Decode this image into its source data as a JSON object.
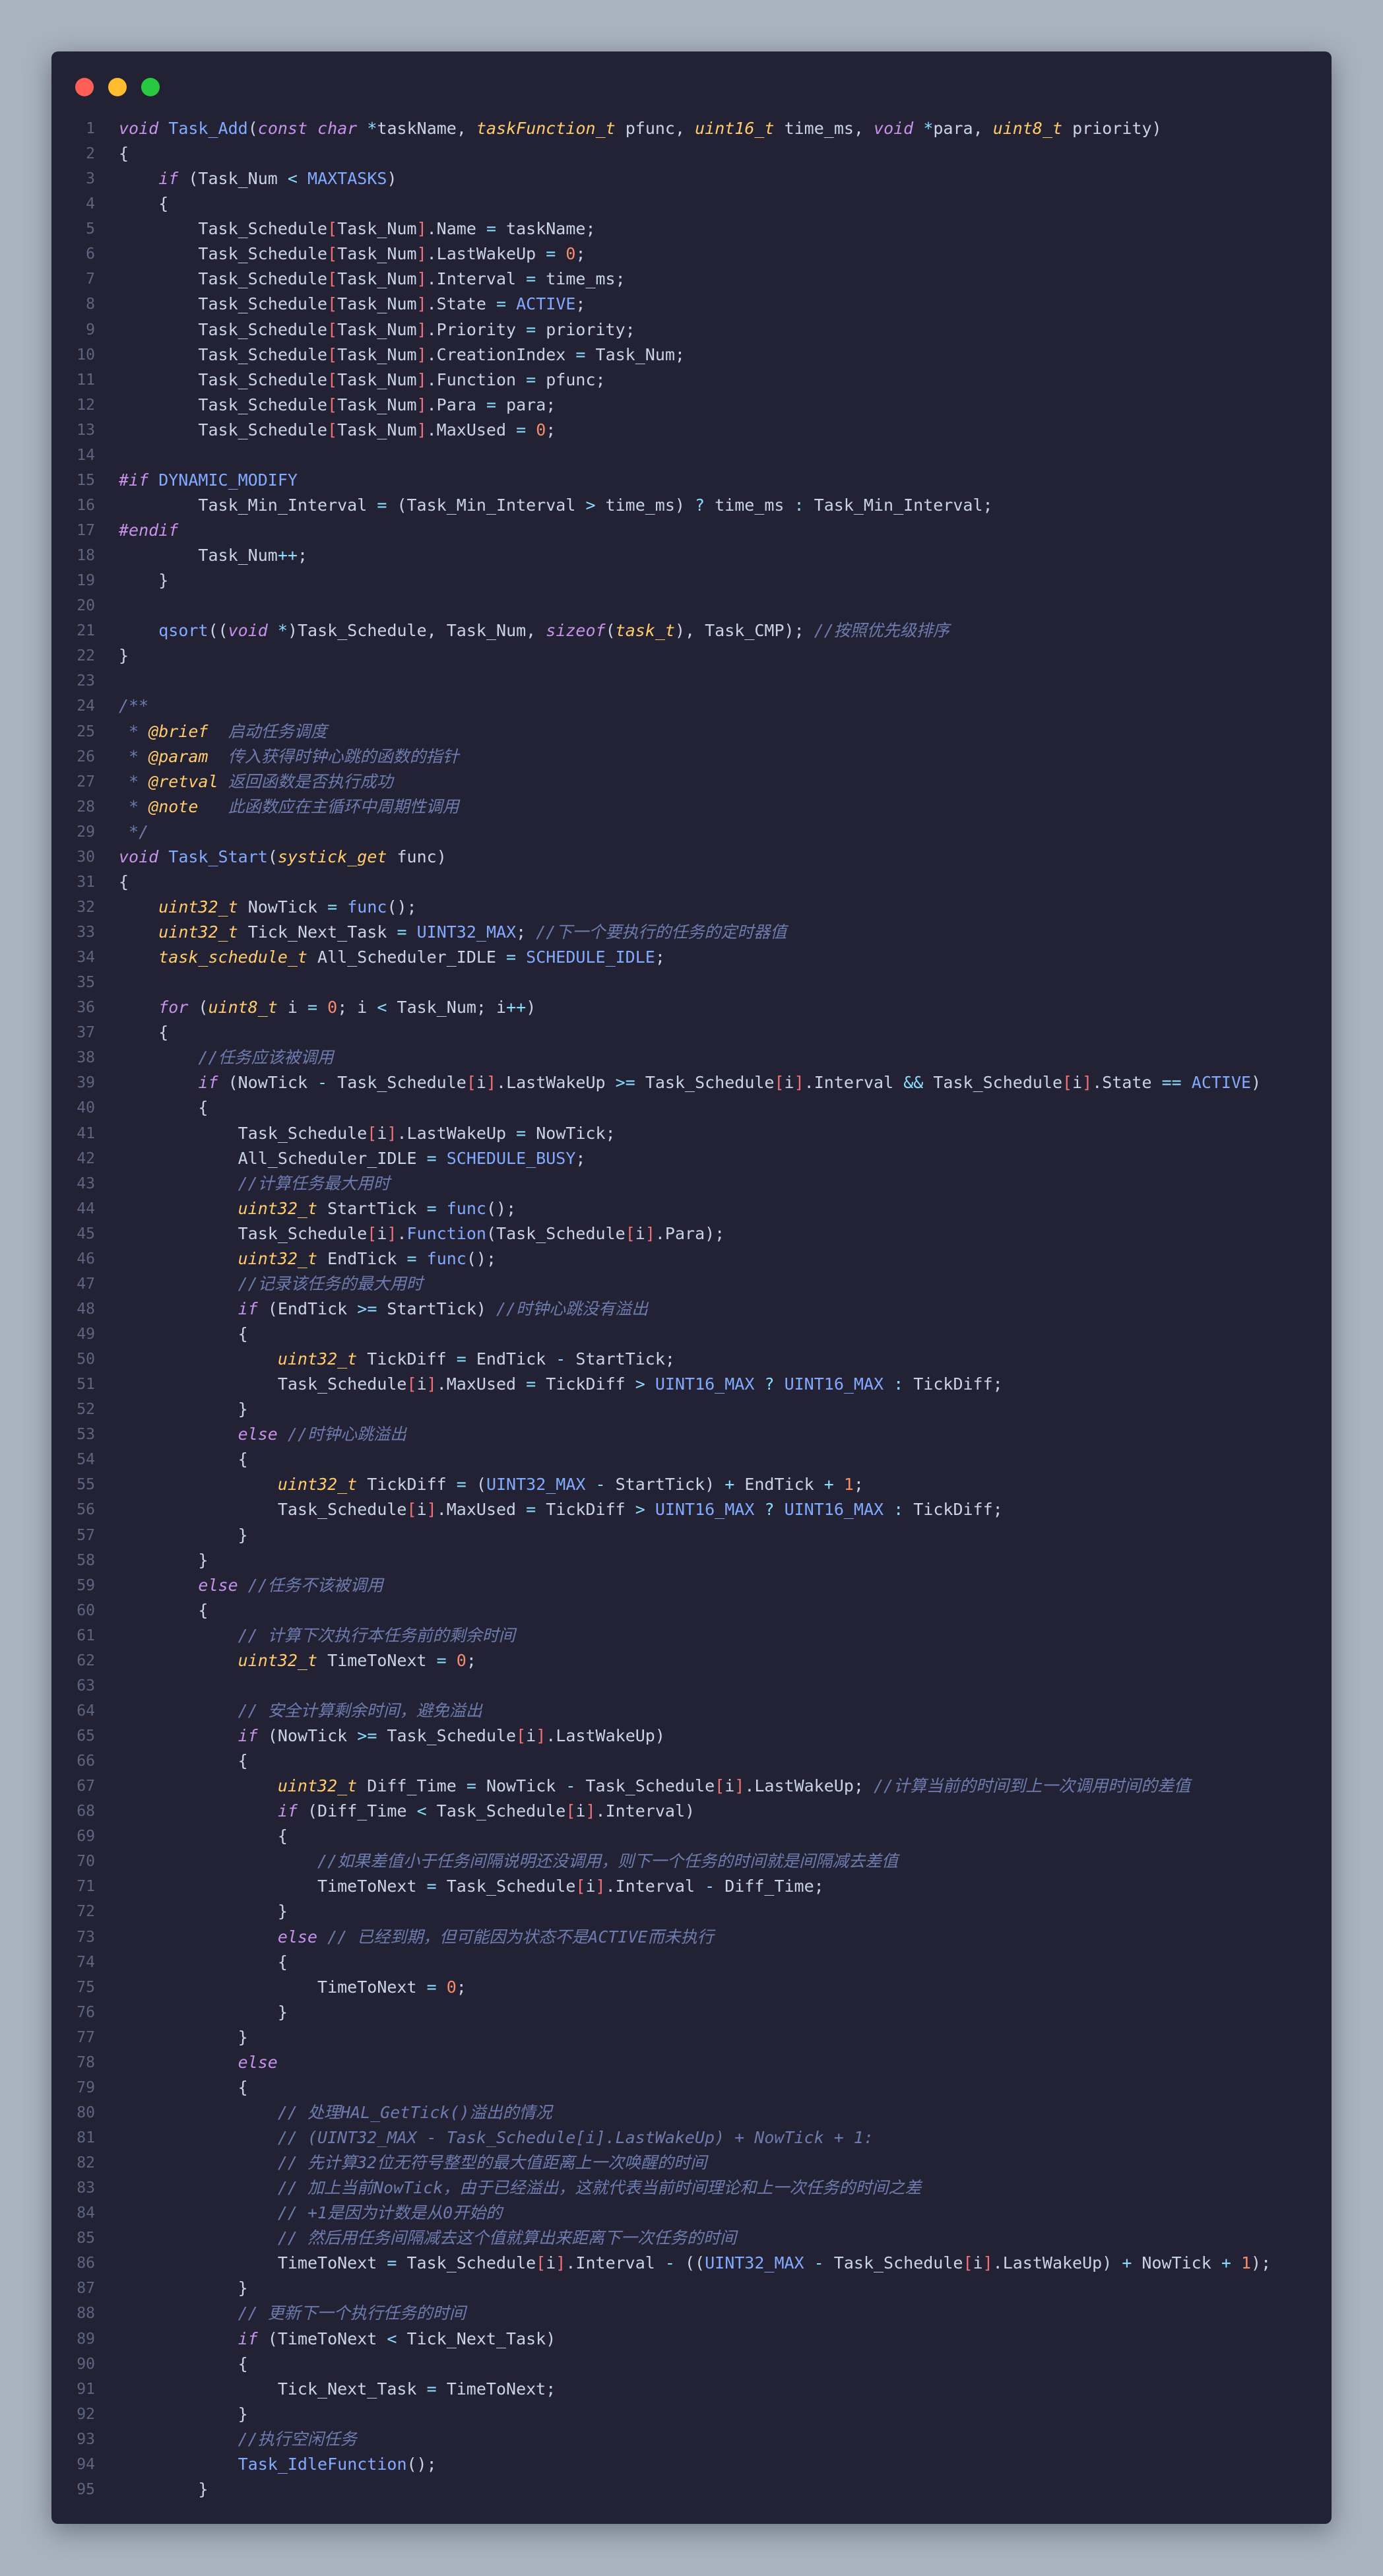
{
  "window": {
    "controls": [
      "close",
      "minimize",
      "maximize"
    ],
    "colors": {
      "close": "#ff5f57",
      "minimize": "#febc2e",
      "maximize": "#28c840",
      "background": "#232235"
    }
  },
  "editor": {
    "language": "c",
    "lines": [
      "void Task_Add(const char *taskName, taskFunction_t pfunc, uint16_t time_ms, void *para, uint8_t priority)",
      "{",
      "    if (Task_Num < MAXTASKS)",
      "    {",
      "        Task_Schedule[Task_Num].Name = taskName;",
      "        Task_Schedule[Task_Num].LastWakeUp = 0;",
      "        Task_Schedule[Task_Num].Interval = time_ms;",
      "        Task_Schedule[Task_Num].State = ACTIVE;",
      "        Task_Schedule[Task_Num].Priority = priority;",
      "        Task_Schedule[Task_Num].CreationIndex = Task_Num;",
      "        Task_Schedule[Task_Num].Function = pfunc;",
      "        Task_Schedule[Task_Num].Para = para;",
      "        Task_Schedule[Task_Num].MaxUsed = 0;",
      "",
      "#if DYNAMIC_MODIFY",
      "        Task_Min_Interval = (Task_Min_Interval > time_ms) ? time_ms : Task_Min_Interval;",
      "#endif",
      "        Task_Num++;",
      "    }",
      "",
      "    qsort((void *)Task_Schedule, Task_Num, sizeof(task_t), Task_CMP); //按照优先级排序",
      "}",
      "",
      "/**",
      " * @brief  启动任务调度",
      " * @param  传入获得时钟心跳的函数的指针",
      " * @retval 返回函数是否执行成功",
      " * @note   此函数应在主循环中周期性调用",
      " */",
      "void Task_Start(systick_get func)",
      "{",
      "    uint32_t NowTick = func();",
      "    uint32_t Tick_Next_Task = UINT32_MAX; //下一个要执行的任务的定时器值",
      "    task_schedule_t All_Scheduler_IDLE = SCHEDULE_IDLE;",
      "",
      "    for (uint8_t i = 0; i < Task_Num; i++)",
      "    {",
      "        //任务应该被调用",
      "        if (NowTick - Task_Schedule[i].LastWakeUp >= Task_Schedule[i].Interval && Task_Schedule[i].State == ACTIVE)",
      "        {",
      "            Task_Schedule[i].LastWakeUp = NowTick;",
      "            All_Scheduler_IDLE = SCHEDULE_BUSY;",
      "            //计算任务最大用时",
      "            uint32_t StartTick = func();",
      "            Task_Schedule[i].Function(Task_Schedule[i].Para);",
      "            uint32_t EndTick = func();",
      "            //记录该任务的最大用时",
      "            if (EndTick >= StartTick) //时钟心跳没有溢出",
      "            {",
      "                uint32_t TickDiff = EndTick - StartTick;",
      "                Task_Schedule[i].MaxUsed = TickDiff > UINT16_MAX ? UINT16_MAX : TickDiff;",
      "            }",
      "            else //时钟心跳溢出",
      "            {",
      "                uint32_t TickDiff = (UINT32_MAX - StartTick) + EndTick + 1;",
      "                Task_Schedule[i].MaxUsed = TickDiff > UINT16_MAX ? UINT16_MAX : TickDiff;",
      "            }",
      "        }",
      "        else //任务不该被调用",
      "        {",
      "            // 计算下次执行本任务前的剩余时间",
      "            uint32_t TimeToNext = 0;",
      "",
      "            // 安全计算剩余时间，避免溢出",
      "            if (NowTick >= Task_Schedule[i].LastWakeUp)",
      "            {",
      "                uint32_t Diff_Time = NowTick - Task_Schedule[i].LastWakeUp; //计算当前的时间到上一次调用时间的差值",
      "                if (Diff_Time < Task_Schedule[i].Interval)",
      "                {",
      "                    //如果差值小于任务间隔说明还没调用，则下一个任务的时间就是间隔减去差值",
      "                    TimeToNext = Task_Schedule[i].Interval - Diff_Time;",
      "                }",
      "                else // 已经到期，但可能因为状态不是ACTIVE而未执行",
      "                {",
      "                    TimeToNext = 0;",
      "                }",
      "            }",
      "            else",
      "            {",
      "                // 处理HAL_GetTick()溢出的情况",
      "                // (UINT32_MAX - Task_Schedule[i].LastWakeUp) + NowTick + 1:",
      "                // 先计算32位无符号整型的最大值距离上一次唤醒的时间",
      "                // 加上当前NowTick，由于已经溢出，这就代表当前时间理论和上一次任务的时间之差",
      "                // +1是因为计数是从0开始的",
      "                // 然后用任务间隔减去这个值就算出来距离下一次任务的时间",
      "                TimeToNext = Task_Schedule[i].Interval - ((UINT32_MAX - Task_Schedule[i].LastWakeUp) + NowTick + 1);",
      "            }",
      "            // 更新下一个执行任务的时间",
      "            if (TimeToNext < Tick_Next_Task)",
      "            {",
      "                Tick_Next_Task = TimeToNext;",
      "            }",
      "            //执行空闲任务",
      "            Task_IdleFunction();",
      "        }"
    ]
  }
}
